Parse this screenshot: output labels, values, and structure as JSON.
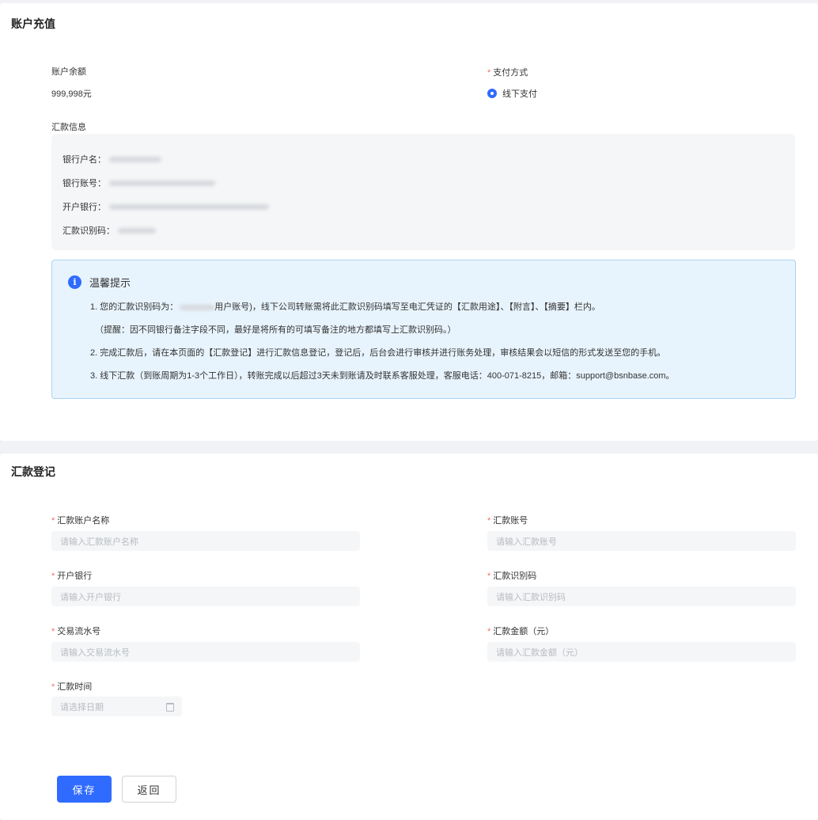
{
  "recharge": {
    "title": "账户充值",
    "balance_label": "账户余额",
    "balance_value": "999,998元",
    "payment_label": "支付方式",
    "payment_option": "线下支付",
    "remit_info_label": "汇款信息",
    "bank": {
      "account_name_label": "银行户名：",
      "account_no_label": "银行账号：",
      "bank_label": "开户银行：",
      "code_label": "汇款识别码："
    },
    "tips": {
      "title": "温馨提示",
      "line1_prefix": "1. 您的汇款识别码为：",
      "line1_suffix": "用户账号)，线下公司转账需将此汇款识别码填写至电汇凭证的【汇款用途】、【附言】、【摘要】栏内。",
      "line2": "（提醒：因不同银行备注字段不同，最好是将所有的可填写备注的地方都填写上汇款识别码。）",
      "line3": "2. 完成汇款后，请在本页面的【汇款登记】进行汇款信息登记，登记后，后台会进行审核并进行账务处理，审核结果会以短信的形式发送至您的手机。",
      "line4": "3. 线下汇款（到账周期为1-3个工作日），转账完成以后超过3天未到账请及时联系客服处理，客服电话：400-071-8215，邮箱：support@bsnbase.com。"
    }
  },
  "register": {
    "title": "汇款登记",
    "required_mark": "*",
    "fields": {
      "account_name": {
        "label": "汇款账户名称",
        "placeholder": "请输入汇款账户名称"
      },
      "account_no": {
        "label": "汇款账号",
        "placeholder": "请输入汇款账号"
      },
      "bank": {
        "label": "开户银行",
        "placeholder": "请输入开户银行"
      },
      "code": {
        "label": "汇款识别码",
        "placeholder": "请输入汇款识别码"
      },
      "serial": {
        "label": "交易流水号",
        "placeholder": "请输入交易流水号"
      },
      "amount": {
        "label": "汇款金额（元）",
        "placeholder": "请输入汇款金额（元）"
      },
      "time": {
        "label": "汇款时间",
        "placeholder": "请选择日期"
      }
    },
    "save_label": "保存",
    "back_label": "返回"
  },
  "colors": {
    "primary": "#2f6bff",
    "required": "#f56c6c",
    "tips_bg": "#e8f4fd",
    "tips_border": "#a8d4f5"
  },
  "icons": {
    "info": "info-icon",
    "calendar": "calendar-icon"
  }
}
